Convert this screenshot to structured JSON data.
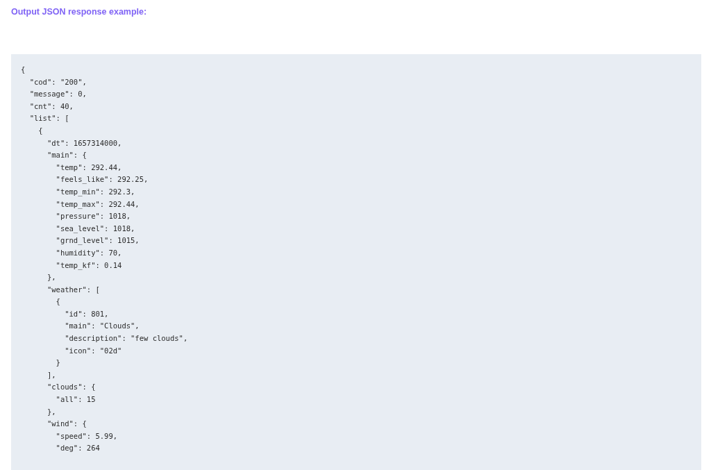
{
  "heading": "Output JSON response example:",
  "code_lines": [
    "{",
    "  \"cod\": \"200\",",
    "  \"message\": 0,",
    "  \"cnt\": 40,",
    "  \"list\": [",
    "    {",
    "      \"dt\": 1657314000,",
    "      \"main\": {",
    "        \"temp\": 292.44,",
    "        \"feels_like\": 292.25,",
    "        \"temp_min\": 292.3,",
    "        \"temp_max\": 292.44,",
    "        \"pressure\": 1018,",
    "        \"sea_level\": 1018,",
    "        \"grnd_level\": 1015,",
    "        \"humidity\": 70,",
    "        \"temp_kf\": 0.14",
    "      },",
    "      \"weather\": [",
    "        {",
    "          \"id\": 801,",
    "          \"main\": \"Clouds\",",
    "          \"description\": \"few clouds\",",
    "          \"icon\": \"02d\"",
    "        }",
    "      ],",
    "      \"clouds\": {",
    "        \"all\": 15",
    "      },",
    "      \"wind\": {",
    "        \"speed\": 5.99,",
    "        \"deg\": 264"
  ]
}
